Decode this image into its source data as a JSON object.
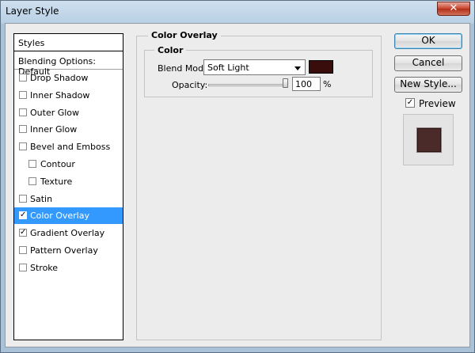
{
  "window": {
    "title": "Layer Style",
    "close_glyph": "✕"
  },
  "styles_list": {
    "header": "Styles",
    "blending_options": "Blending Options: Default",
    "items": [
      {
        "label": "Drop Shadow",
        "checked": false,
        "indent": false,
        "selected": false
      },
      {
        "label": "Inner Shadow",
        "checked": false,
        "indent": false,
        "selected": false
      },
      {
        "label": "Outer Glow",
        "checked": false,
        "indent": false,
        "selected": false
      },
      {
        "label": "Inner Glow",
        "checked": false,
        "indent": false,
        "selected": false
      },
      {
        "label": "Bevel and Emboss",
        "checked": false,
        "indent": false,
        "selected": false
      },
      {
        "label": "Contour",
        "checked": false,
        "indent": true,
        "selected": false
      },
      {
        "label": "Texture",
        "checked": false,
        "indent": true,
        "selected": false
      },
      {
        "label": "Satin",
        "checked": false,
        "indent": false,
        "selected": false
      },
      {
        "label": "Color Overlay",
        "checked": true,
        "indent": false,
        "selected": true
      },
      {
        "label": "Gradient Overlay",
        "checked": true,
        "indent": false,
        "selected": false
      },
      {
        "label": "Pattern Overlay",
        "checked": false,
        "indent": false,
        "selected": false
      },
      {
        "label": "Stroke",
        "checked": false,
        "indent": false,
        "selected": false
      }
    ]
  },
  "panel": {
    "title": "Color Overlay",
    "section": "Color",
    "blend_mode_label": "Blend Mode:",
    "blend_mode_value": "Soft Light",
    "overlay_color": "#3a0d0d",
    "opacity_label": "Opacity:",
    "opacity_value": "100",
    "opacity_fraction": 1.0,
    "opacity_unit": "%"
  },
  "buttons": {
    "ok": "OK",
    "cancel": "Cancel",
    "new_style": "New Style...",
    "preview_label": "Preview",
    "preview_checked": true
  },
  "colors": {
    "selection": "#3399ff",
    "preview_swatch": "#4b2a2a"
  }
}
